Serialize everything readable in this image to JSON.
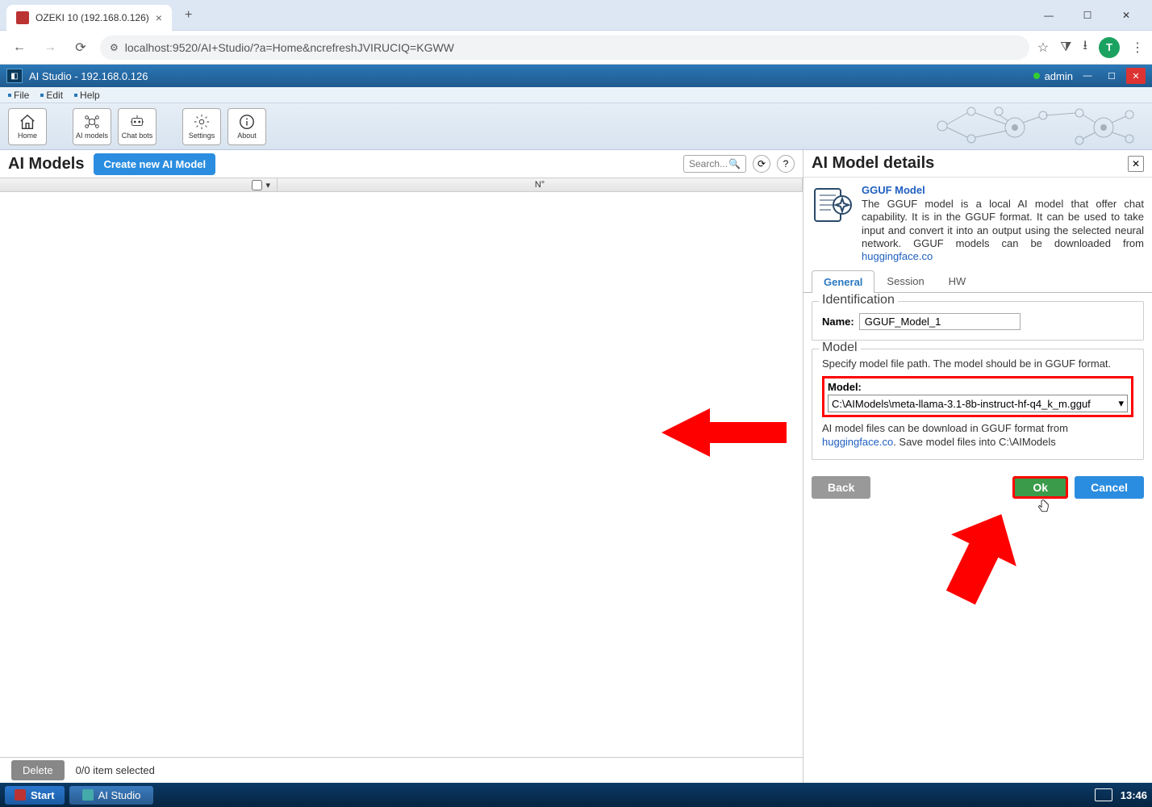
{
  "browser": {
    "tab_title": "OZEKI 10 (192.168.0.126)",
    "url": "localhost:9520/AI+Studio/?a=Home&ncrefreshJVIRUCIQ=KGWW",
    "avatar_initial": "T"
  },
  "app": {
    "title": "AI Studio - 192.168.0.126",
    "user": "admin",
    "menu": [
      "File",
      "Edit",
      "Help"
    ],
    "toolbar": [
      {
        "label": "Home",
        "icon": "home"
      },
      {
        "label": "AI models",
        "icon": "models"
      },
      {
        "label": "Chat bots",
        "icon": "bots"
      },
      {
        "label": "Settings",
        "icon": "gear"
      },
      {
        "label": "About",
        "icon": "info"
      }
    ]
  },
  "left": {
    "title": "AI Models",
    "create_label": "Create new AI Model",
    "search_placeholder": "Search...",
    "columns": {
      "checkbox": "",
      "no": "N°"
    },
    "delete_label": "Delete",
    "selection_status": "0/0 item selected"
  },
  "right": {
    "title": "AI Model details",
    "model_name": "GGUF Model",
    "model_desc": "The GGUF model is a local AI model that offer chat capability. It is in the GGUF format. It can be used to take input and convert it into an output using the selected neural network. GGUF models can be downloaded from ",
    "model_link": "huggingface.co",
    "tabs": [
      "General",
      "Session",
      "HW"
    ],
    "active_tab": 0,
    "identification": {
      "legend": "Identification",
      "name_label": "Name:",
      "name_value": "GGUF_Model_1"
    },
    "model_section": {
      "legend": "Model",
      "desc": "Specify model file path. The model should be in GGUF format.",
      "model_label": "Model:",
      "model_value": "C:\\AIModels\\meta-llama-3.1-8b-instruct-hf-q4_k_m.gguf",
      "help_pre": "AI model files can be download in GGUF format from ",
      "help_link": "huggingface.co",
      "help_post": ". Save model files into C:\\AIModels"
    },
    "buttons": {
      "back": "Back",
      "ok": "Ok",
      "cancel": "Cancel"
    }
  },
  "taskbar": {
    "start": "Start",
    "app": "AI Studio",
    "time": "13:46"
  }
}
